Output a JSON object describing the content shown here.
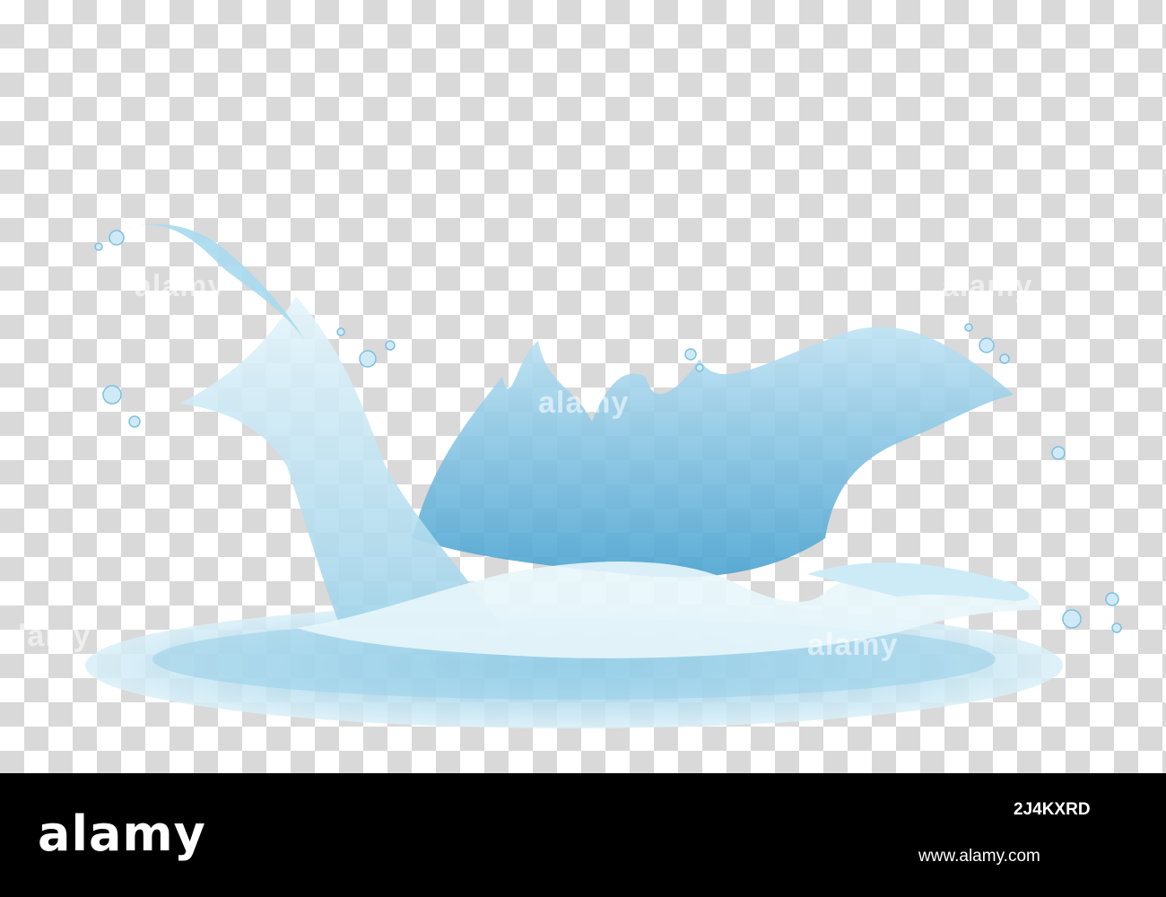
{
  "image": {
    "subject": "water splash crown with drops",
    "background": "transparent checkerboard",
    "colors": {
      "water_light": "#d6eef8",
      "water_mid": "#8ccbe6",
      "water_dark": "#4aa3d1",
      "checker": "#d9d9d9",
      "bar": "#000000"
    }
  },
  "watermark": {
    "text": "alamy"
  },
  "footer": {
    "logo": "alamy",
    "image_id": "2J4KXRD",
    "url": "www.alamy.com"
  }
}
